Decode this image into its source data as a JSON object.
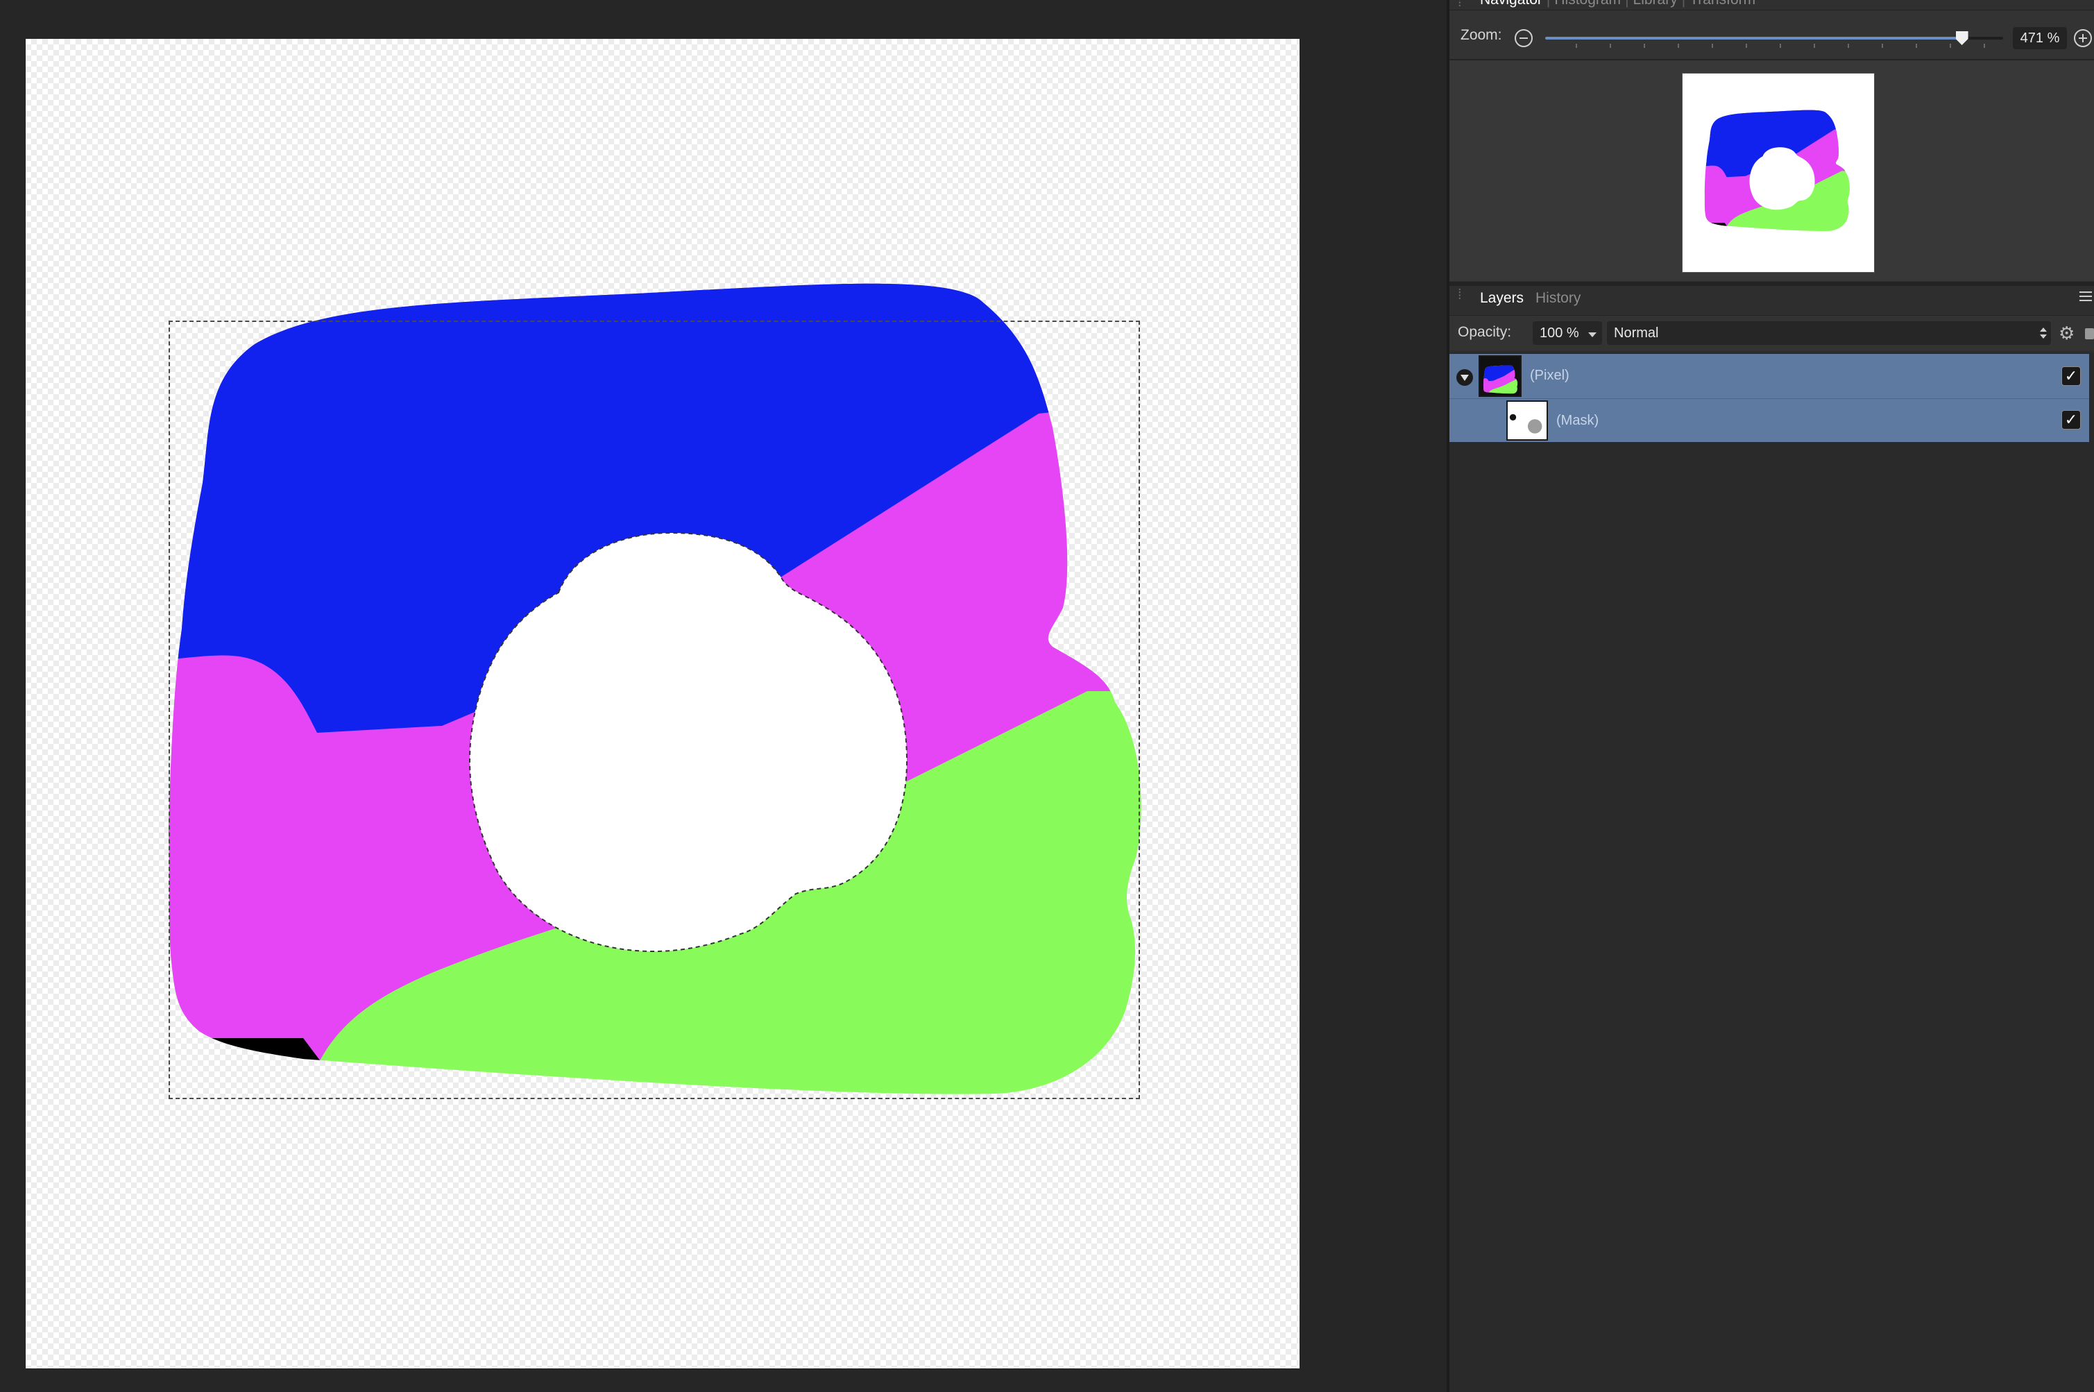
{
  "navigator_panel": {
    "tabs": [
      "Navigator",
      "Histogram",
      "Library",
      "Transform"
    ],
    "active_tab": "Navigator",
    "zoom_label": "Zoom:",
    "zoom_value": "471 %",
    "zoom_slider_fraction": 0.91
  },
  "layers_panel": {
    "tabs": [
      "Layers",
      "History"
    ],
    "active_tab": "Layers",
    "opacity_label": "Opacity:",
    "opacity_value": "100 %",
    "blend_mode": "Normal",
    "layers": [
      {
        "name": "(Pixel)",
        "visible": true,
        "selected": true,
        "expanded": true
      },
      {
        "name": "(Mask)",
        "visible": true,
        "selected": true
      }
    ]
  },
  "artwork_colors": {
    "blue": "#1122ee",
    "magenta": "#e545f5",
    "green": "#88fb5a",
    "black": "#000000",
    "selection_highlight": "#5e7aa0"
  },
  "icons": {
    "zoom_out": "minus-circle-icon",
    "zoom_in": "plus-circle-icon",
    "settings": "gear-icon",
    "lock": "lock-icon",
    "menu": "hamburger-icon",
    "expand": "disclosure-triangle-icon",
    "visibility": "checkmark-icon"
  }
}
